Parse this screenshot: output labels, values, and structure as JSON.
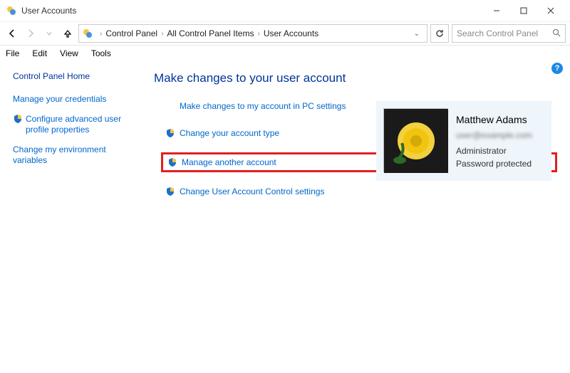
{
  "window": {
    "title": "User Accounts"
  },
  "breadcrumb": [
    "Control Panel",
    "All Control Panel Items",
    "User Accounts"
  ],
  "search": {
    "placeholder": "Search Control Panel"
  },
  "menus": [
    "File",
    "Edit",
    "View",
    "Tools"
  ],
  "sidebar": {
    "home": "Control Panel Home",
    "links": [
      {
        "label": "Manage your credentials",
        "shield": false
      },
      {
        "label": "Configure advanced user profile properties",
        "shield": true
      },
      {
        "label": "Change my environment variables",
        "shield": false
      }
    ]
  },
  "main": {
    "heading": "Make changes to your user account",
    "actions": [
      {
        "label": "Make changes to my account in PC settings",
        "shield": false,
        "highlight": false
      },
      {
        "label": "Change your account type",
        "shield": true,
        "highlight": false
      },
      {
        "label": "Manage another account",
        "shield": true,
        "highlight": true
      },
      {
        "label": "Change User Account Control settings",
        "shield": true,
        "highlight": false
      }
    ]
  },
  "user": {
    "name": "Matthew Adams",
    "email": "user@example.com",
    "role": "Administrator",
    "protection": "Password protected"
  }
}
